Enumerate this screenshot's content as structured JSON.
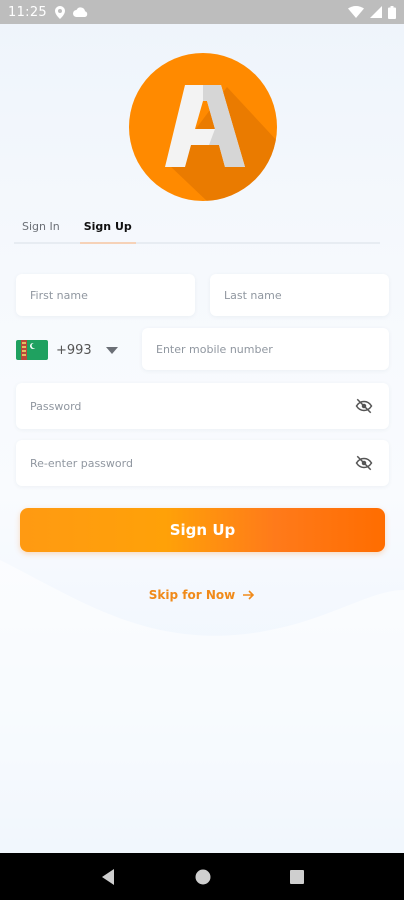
{
  "status_bar": {
    "time": "11:25",
    "icons_left": [
      "location-icon",
      "cloud-icon"
    ],
    "icons_right": [
      "wifi-icon",
      "signal-icon",
      "battery-icon"
    ]
  },
  "logo": {
    "letter": "A",
    "color": "#ff8a00"
  },
  "tabs": [
    {
      "label": "Sign In",
      "active": false
    },
    {
      "label": "Sign Up",
      "active": true
    }
  ],
  "form": {
    "first_name": {
      "placeholder": "First name",
      "value": ""
    },
    "last_name": {
      "placeholder": "Last name",
      "value": ""
    },
    "country_code": "+993",
    "country_flag": "turkmenistan-flag",
    "mobile": {
      "placeholder": "Enter mobile number",
      "value": ""
    },
    "password": {
      "placeholder": "Password",
      "value": ""
    },
    "confirm_password": {
      "placeholder": "Re-enter password",
      "value": ""
    }
  },
  "signup_button": {
    "label": "Sign Up"
  },
  "skip_link": {
    "label": "Skip for Now"
  },
  "colors": {
    "accent": "#ff8a00",
    "accent_text": "#f08a1a",
    "placeholder": "#9097a0"
  }
}
